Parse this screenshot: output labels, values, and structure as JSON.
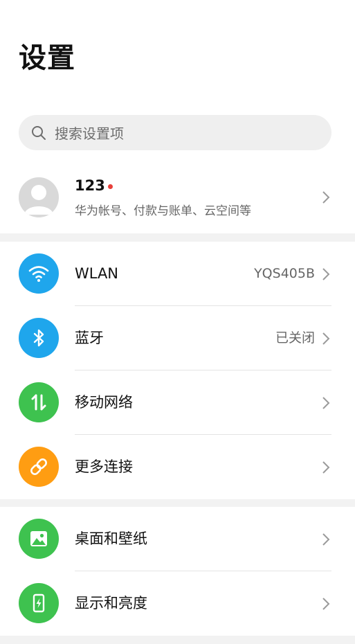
{
  "header": {
    "title": "设置"
  },
  "search": {
    "placeholder": "搜索设置项"
  },
  "account": {
    "name": "123",
    "subtitle": "华为帐号、付款与账单、云空间等"
  },
  "colors": {
    "wlan": "#1fa6ec",
    "bluetooth": "#1fa6ec",
    "mobile_network": "#3ec24f",
    "more_connections": "#ff9d12",
    "wallpaper": "#3ec24f",
    "display": "#3ec24f",
    "notification_dot": "#e8403a"
  },
  "sections": [
    {
      "items": [
        {
          "label": "WLAN",
          "value": "YQS405B",
          "icon": "wifi-icon"
        },
        {
          "label": "蓝牙",
          "value": "已关闭",
          "icon": "bluetooth-icon"
        },
        {
          "label": "移动网络",
          "value": "",
          "icon": "mobile-data-icon"
        },
        {
          "label": "更多连接",
          "value": "",
          "icon": "link-icon"
        }
      ]
    },
    {
      "items": [
        {
          "label": "桌面和壁纸",
          "value": "",
          "icon": "wallpaper-icon"
        },
        {
          "label": "显示和亮度",
          "value": "",
          "icon": "display-brightness-icon"
        }
      ]
    }
  ]
}
